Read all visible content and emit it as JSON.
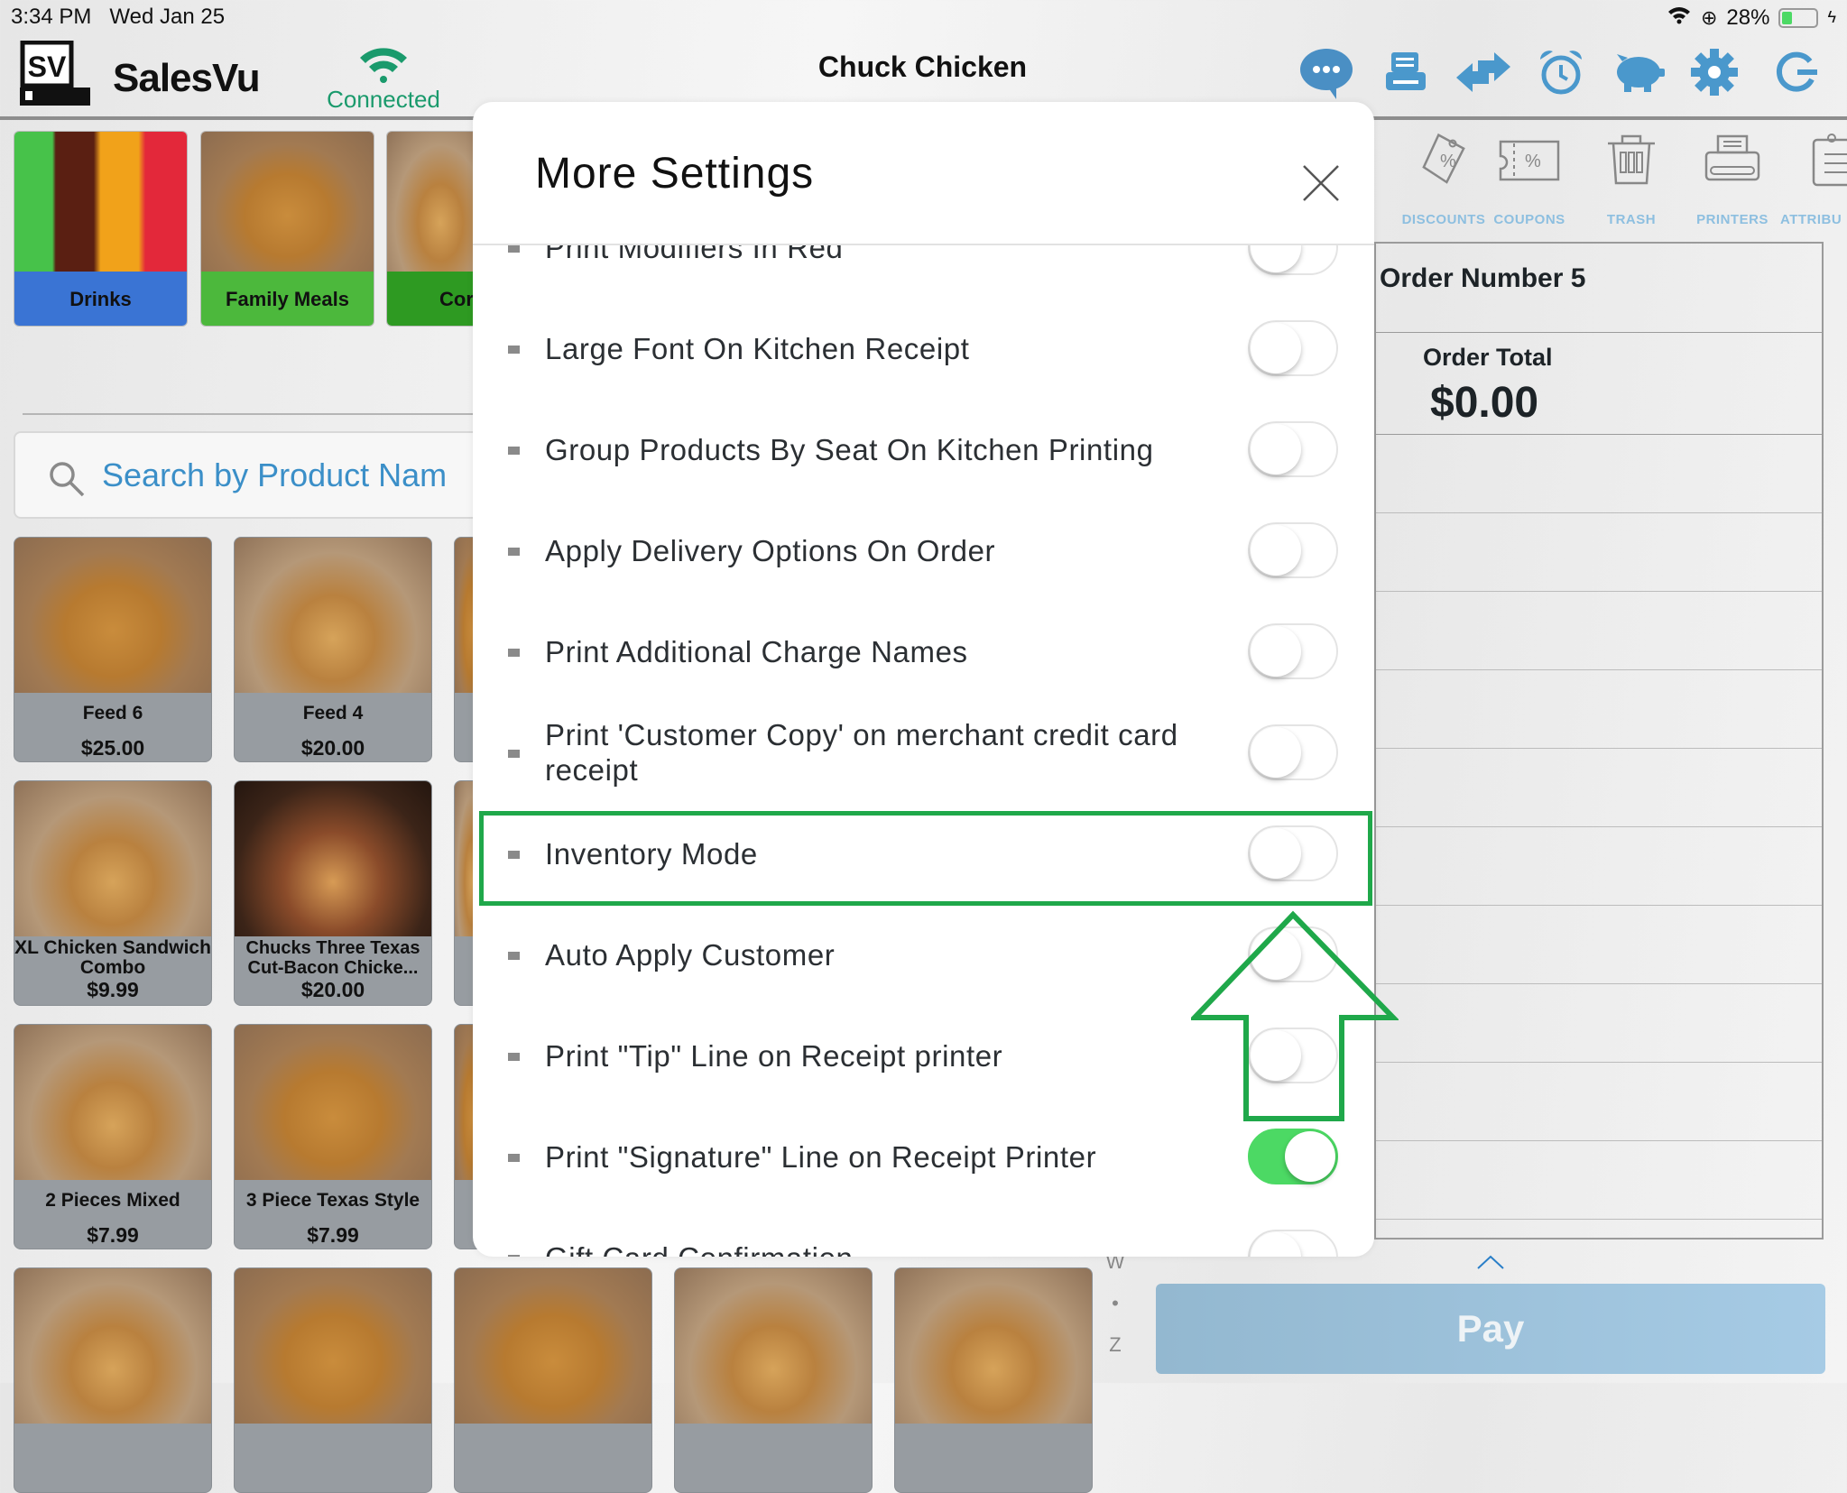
{
  "status_bar": {
    "time": "3:34 PM",
    "date": "Wed Jan 25",
    "battery": "28%",
    "battery_level": 0.28
  },
  "header": {
    "brand": "SalesVu",
    "logo_text": "SV",
    "connection": "Connected",
    "store_name": "Chuck Chicken",
    "icons": [
      "chat-icon",
      "register-icon",
      "transfer-icon",
      "alarm-clock-icon",
      "piggy-bank-icon",
      "gear-icon",
      "refresh-icon"
    ],
    "accent": "#4a98cc",
    "connected_color": "#1a9a6c"
  },
  "categories": [
    {
      "label": "Drinks",
      "color": "#3a74d4"
    },
    {
      "label": "Family Meals",
      "color": "#4cb83c"
    },
    {
      "label": "Cor",
      "color": "#2e9a22"
    }
  ],
  "search": {
    "placeholder": "Search by Product Nam"
  },
  "products": [
    {
      "name": "Feed 6",
      "price": "$25.00"
    },
    {
      "name": "Feed 4",
      "price": "$20.00"
    },
    {
      "name": "XL Chicken Sandwich Combo",
      "price": "$9.99"
    },
    {
      "name": "Chucks Three Texas Cut-Bacon Chicke...",
      "price": "$20.00"
    },
    {
      "name": "2 Pieces Mixed",
      "price": "$7.99"
    },
    {
      "name": "3 Piece Texas Style",
      "price": "$7.99"
    }
  ],
  "index_letters": [
    "W",
    "•",
    "Z"
  ],
  "tools": [
    {
      "label": "DISCOUNTS",
      "icon": "discount-tag-icon"
    },
    {
      "label": "COUPONS",
      "icon": "coupon-icon"
    },
    {
      "label": "TRASH",
      "icon": "trash-icon"
    },
    {
      "label": "PRINTERS",
      "icon": "printer-icon"
    },
    {
      "label": "ATTRIBU",
      "icon": "clipboard-icon"
    }
  ],
  "order": {
    "number_label": "Order Number 5",
    "total_label": "Order Total",
    "total": "$0.00"
  },
  "pay": {
    "label": "Pay"
  },
  "modal": {
    "title": "More Settings",
    "settings": [
      {
        "label": "Print Modifiers In Red",
        "on": false
      },
      {
        "label": "Large Font On Kitchen Receipt",
        "on": false
      },
      {
        "label": "Group Products By Seat On Kitchen Printing",
        "on": false
      },
      {
        "label": "Apply Delivery Options On Order",
        "on": false
      },
      {
        "label": "Print Additional Charge Names",
        "on": false
      },
      {
        "label": "Print 'Customer Copy' on merchant credit card receipt",
        "on": false
      },
      {
        "label": "Inventory Mode",
        "on": false
      },
      {
        "label": "Auto Apply Customer",
        "on": false
      },
      {
        "label": "Print \"Tip\" Line on Receipt printer",
        "on": false
      },
      {
        "label": "Print \"Signature\" Line on Receipt Printer",
        "on": true
      },
      {
        "label": "Gift Card Confirmation",
        "on": false
      }
    ],
    "toggle_on_color": "#4cd964",
    "highlight_color": "#1fa84a"
  }
}
